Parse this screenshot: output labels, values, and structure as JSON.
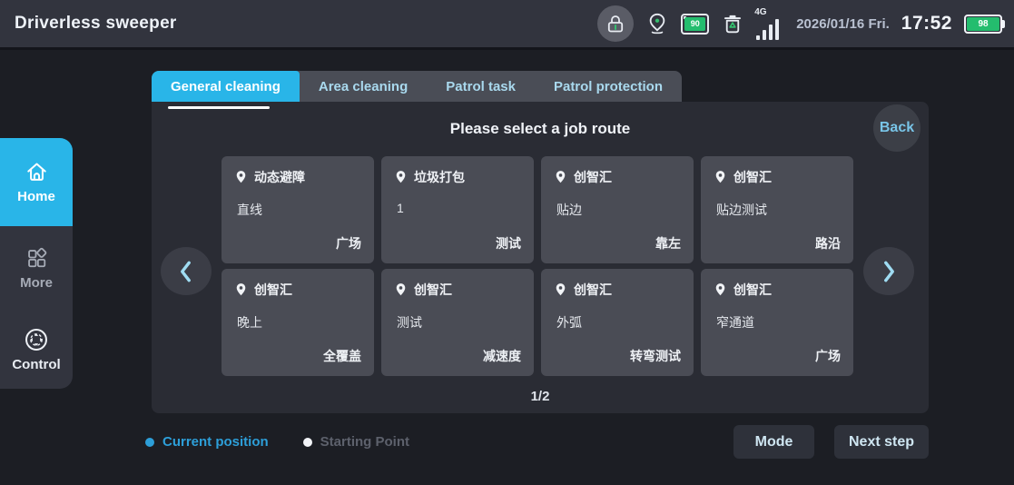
{
  "colors": {
    "accent": "#29b5e8",
    "green": "#24bd6e",
    "topbar_bg": "#32343e",
    "page_bg": "#1c1e24",
    "panel_bg": "#2a2c34",
    "card_bg": "#4a4c55",
    "legend_current": "#2d9fd9",
    "legend_start": "#f2f4f8"
  },
  "top_bar": {
    "title": "Driverless sweeper",
    "lock_icon": "lock-icon",
    "location_icon": "location-pin-icon",
    "tank_level": "90",
    "trash_icon": "trash-recycle-icon",
    "network_label": "4G",
    "date": "2026/01/16 Fri.",
    "time": "17:52",
    "battery_percent": "98"
  },
  "sidebar": {
    "items": [
      {
        "label": "Home",
        "icon": "home-icon",
        "active": true
      },
      {
        "label": "More",
        "icon": "more-grid-icon",
        "active": false
      },
      {
        "label": "Control",
        "icon": "control-dpad-icon",
        "active": false
      }
    ]
  },
  "tabs": [
    {
      "label": "General cleaning",
      "active": true
    },
    {
      "label": "Area cleaning",
      "active": false
    },
    {
      "label": "Patrol task",
      "active": false
    },
    {
      "label": "Patrol protection",
      "active": false
    }
  ],
  "main": {
    "title": "Please select a job route",
    "back_label": "Back",
    "pagination": "1/2",
    "cards": [
      {
        "name": "动态避障",
        "route": "直线",
        "tag": "广场"
      },
      {
        "name": "垃圾打包",
        "route": "1",
        "tag": "测试"
      },
      {
        "name": "创智汇",
        "route": "贴边",
        "tag": "靠左"
      },
      {
        "name": "创智汇",
        "route": "贴边测试",
        "tag": "路沿"
      },
      {
        "name": "创智汇",
        "route": "晚上",
        "tag": "全覆盖"
      },
      {
        "name": "创智汇",
        "route": "测试",
        "tag": "减速度"
      },
      {
        "name": "创智汇",
        "route": "外弧",
        "tag": "转弯测试"
      },
      {
        "name": "创智汇",
        "route": "窄通道",
        "tag": "广场"
      }
    ]
  },
  "footer": {
    "legend": [
      {
        "label": "Current position"
      },
      {
        "label": "Starting Point"
      }
    ],
    "mode_label": "Mode",
    "next_label": "Next step"
  }
}
